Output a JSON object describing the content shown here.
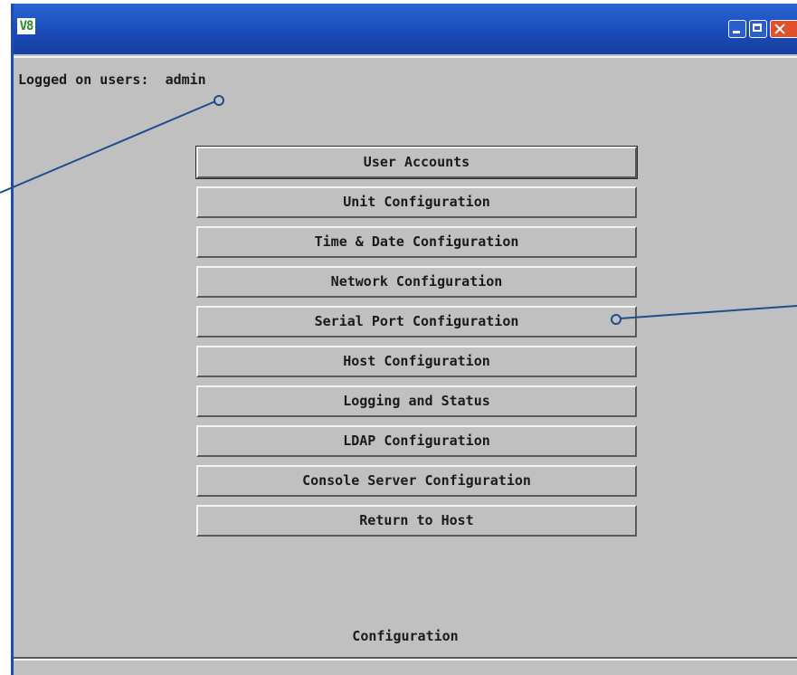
{
  "window": {
    "logo_text": "V",
    "logo_suffix": "8"
  },
  "session": {
    "label": "Logged on users:",
    "user": "admin"
  },
  "menu": {
    "items": [
      {
        "label": "User Accounts"
      },
      {
        "label": "Unit Configuration"
      },
      {
        "label": "Time & Date Configuration"
      },
      {
        "label": "Network Configuration"
      },
      {
        "label": "Serial Port Configuration"
      },
      {
        "label": "Host Configuration"
      },
      {
        "label": "Logging and Status"
      },
      {
        "label": "LDAP Configuration"
      },
      {
        "label": "Console Server Configuration"
      },
      {
        "label": "Return to Host"
      }
    ]
  },
  "footer": {
    "label": "Configuration"
  },
  "colors": {
    "titlebar": "#1a49b8",
    "background": "#c0c0c0",
    "callout_line": "#1f4e8c"
  }
}
